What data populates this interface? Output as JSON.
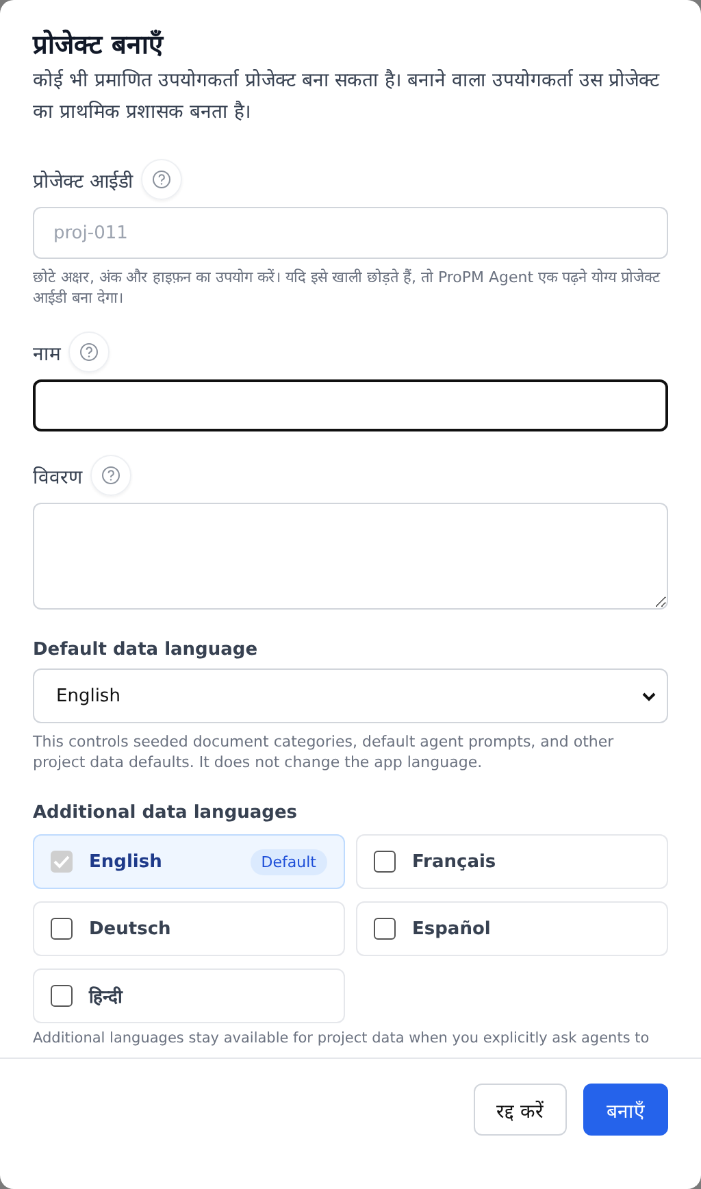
{
  "dialog": {
    "title": "प्रोजेक्ट बनाएँ",
    "description": "कोई भी प्रमाणित उपयोगकर्ता प्रोजेक्ट बना सकता है। बनाने वाला उपयोगकर्ता उस प्रोजेक्ट का प्राथमिक प्रशासक बनता है।"
  },
  "fields": [
    {
      "kind": "input",
      "label": "प्रोजेक्ट आईडी",
      "placeholder": "proj-011",
      "hint": "छोटे अक्षर, अंक और हाइफ़न का उपयोग करें। यदि इसे खाली छोड़ते हैं, तो ProPM Agent एक पढ़ने योग्य प्रोजेक्ट आईडी बना देगा।",
      "focused": false
    },
    {
      "kind": "input",
      "label": "नाम",
      "focused": true
    },
    {
      "kind": "textarea",
      "label": "विवरण",
      "focused": false
    }
  ],
  "default_language": {
    "label": "Default data language",
    "value": "English",
    "hint": "This controls seeded document categories, default agent prompts, and other project data defaults. It does not change the app language."
  },
  "additional_languages": {
    "label": "Additional data languages",
    "items": [
      {
        "label": "English",
        "checked": true,
        "disabled": true,
        "badge": "Default"
      },
      {
        "label": "Français",
        "checked": false,
        "disabled": false
      },
      {
        "label": "Deutsch",
        "checked": false,
        "disabled": false
      },
      {
        "label": "Español",
        "checked": false,
        "disabled": false
      },
      {
        "label": "हिन्दी",
        "checked": false,
        "disabled": false
      }
    ],
    "hint": "Additional languages stay available for project data when you explicitly ask agents to"
  },
  "buttons": [
    {
      "kind": "secondary",
      "label": "रद्द करें"
    },
    {
      "kind": "primary",
      "label": "बनाएँ"
    }
  ]
}
